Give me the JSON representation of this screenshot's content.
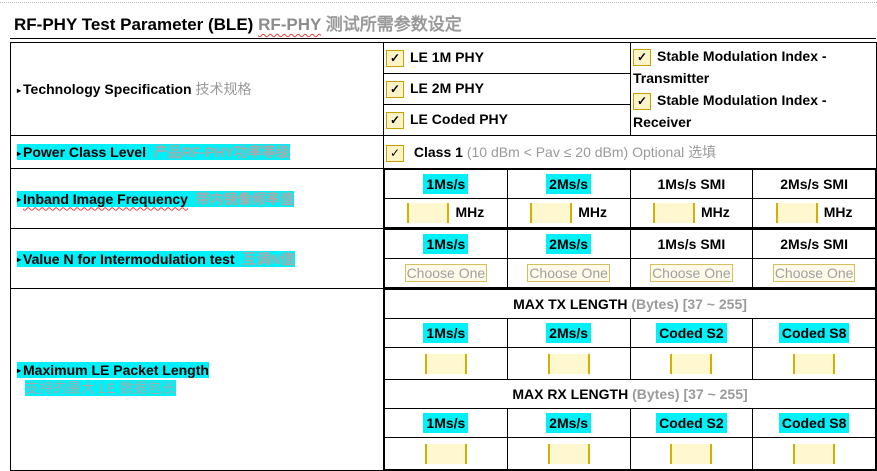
{
  "header": {
    "title_main": "RF-PHY Test Parameter (BLE)",
    "title_sub": "RF-PHY",
    "title_cn": "测试所需参数设定"
  },
  "technology": {
    "label": "Technology Specification",
    "label_cn": "技术规格",
    "options": [
      "LE 1M PHY",
      "LE 2M PHY",
      "LE Coded PHY"
    ],
    "modulation": [
      "Stable Modulation Index - Transmitter",
      "Stable Modulation Index - Receiver"
    ]
  },
  "power_class": {
    "label": "Power Class Level",
    "label_cn": "产品RF-PHY功率等级",
    "class_name": "Class 1",
    "class_detail": "(10 dBm < Pav ≤ 20 dBm) Optional",
    "class_cn": "选填"
  },
  "inband": {
    "label": "Inband Image Frequency",
    "label_cn": "带内镜像频率值",
    "columns": [
      "1Ms/s",
      "2Ms/s",
      "1Ms/s SMI",
      "2Ms/s SMI"
    ],
    "unit": "MHz"
  },
  "intermod": {
    "label": "Value N for Intermodulation test",
    "label_cn": "互调N值",
    "columns": [
      "1Ms/s",
      "2Ms/s",
      "1Ms/s SMI",
      "2Ms/s SMI"
    ],
    "placeholder": "Choose One"
  },
  "packet": {
    "label": "Maximum LE Packet Length",
    "label_cn": "支持的最大 LE 数据包长",
    "tx_title": "MAX TX LENGTH",
    "rx_title": "MAX RX LENGTH",
    "unit_note": "(Bytes)",
    "range": "[37 ~ 255]",
    "columns": [
      "1Ms/s",
      "2Ms/s",
      "Coded S2",
      "Coded S8"
    ]
  }
}
